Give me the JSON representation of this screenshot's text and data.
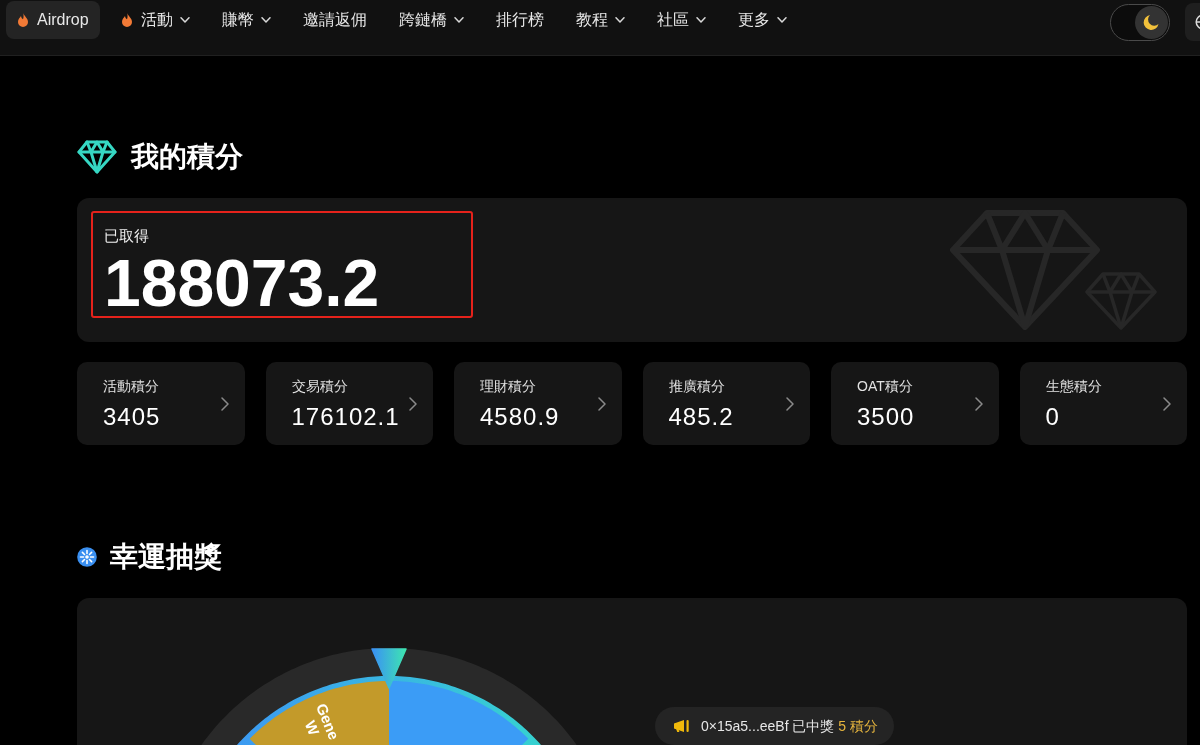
{
  "nav": {
    "items": [
      {
        "label": "Airdrop",
        "hot": true,
        "dropdown": false,
        "selected": true
      },
      {
        "label": "活動",
        "hot": true,
        "dropdown": true,
        "selected": false
      },
      {
        "label": "賺幣",
        "hot": false,
        "dropdown": true,
        "selected": false
      },
      {
        "label": "邀請返佣",
        "hot": false,
        "dropdown": false,
        "selected": false
      },
      {
        "label": "跨鏈橋",
        "hot": false,
        "dropdown": true,
        "selected": false
      },
      {
        "label": "排行榜",
        "hot": false,
        "dropdown": false,
        "selected": false
      },
      {
        "label": "教程",
        "hot": false,
        "dropdown": true,
        "selected": false
      },
      {
        "label": "社區",
        "hot": false,
        "dropdown": true,
        "selected": false
      },
      {
        "label": "更多",
        "hot": false,
        "dropdown": true,
        "selected": false
      }
    ],
    "theme_toggle": {
      "on": true
    }
  },
  "points": {
    "title": "我的積分",
    "earned": {
      "label": "已取得",
      "value": "188073.2",
      "highlighted": true
    },
    "categories": [
      {
        "label": "活動積分",
        "value": "3405"
      },
      {
        "label": "交易積分",
        "value": "176102.1"
      },
      {
        "label": "理財積分",
        "value": "4580.9"
      },
      {
        "label": "推廣積分",
        "value": "485.2"
      },
      {
        "label": "OAT積分",
        "value": "3500"
      },
      {
        "label": "生態積分",
        "value": "0"
      }
    ]
  },
  "lottery": {
    "title": "幸運抽獎",
    "wheel": {
      "segments": [
        {
          "lines": [
            "Gene",
            "W"
          ],
          "color": "#c39a2a"
        },
        {
          "color": "#3b9cf6"
        }
      ]
    },
    "ticker": {
      "address": "0×15a5...eeBf",
      "message": "已中獎",
      "prize": "5 積分"
    }
  }
}
